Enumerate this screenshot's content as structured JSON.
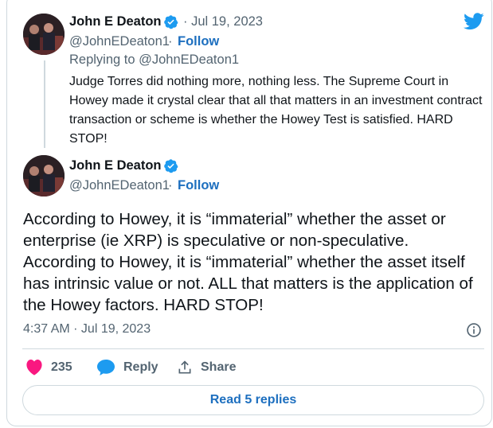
{
  "reply_tweet": {
    "author_name": "John E Deaton",
    "date": "· Jul 19, 2023",
    "handle": "@JohnEDeaton1",
    "separator": "·",
    "follow_label": "Follow",
    "replying_to": "Replying to @JohnEDeaton1",
    "text": "Judge Torres did nothing more, nothing less. The Supreme Court in Howey made it crystal clear that all that matters in an investment contract transaction or scheme is whether the Howey Test is satisfied. HARD STOP!"
  },
  "main_tweet": {
    "author_name": "John E Deaton",
    "handle": "@JohnEDeaton1",
    "separator": "·",
    "follow_label": "Follow",
    "text": "According to Howey, it is “immaterial” whether the asset or enterprise (ie XRP) is speculative or non-speculative. According to Howey, it is “immaterial” whether the asset itself has intrinsic value or not. ALL that matters is the application of the Howey factors. HARD STOP!",
    "timestamp": "4:37 AM · Jul 19, 2023"
  },
  "actions": {
    "like_count": "235",
    "reply_label": "Reply",
    "share_label": "Share"
  },
  "read_replies_label": "Read 5 replies",
  "colors": {
    "accent": "#1d9bf0",
    "link": "#1d6fbf",
    "like": "#f91880",
    "muted": "#536471",
    "border": "#cfd9de"
  },
  "icons": [
    "twitter-bird-icon",
    "verified-badge-icon",
    "info-icon",
    "heart-icon",
    "reply-bubble-icon",
    "share-icon"
  ]
}
